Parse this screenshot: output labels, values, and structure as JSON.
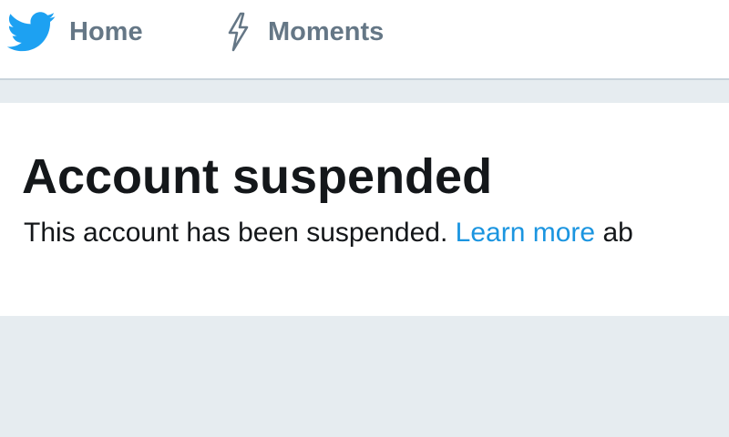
{
  "nav": {
    "home_label": "Home",
    "moments_label": "Moments",
    "brand_icon": "twitter-bird-icon",
    "moments_icon": "lightning-bolt-icon"
  },
  "main": {
    "title": "Account suspended",
    "message": "This account has been suspended.",
    "link_text": "Learn more",
    "trailing_text": "ab"
  },
  "colors": {
    "brand": "#1da1f2",
    "link": "#1b95e0",
    "nav_text": "#657786",
    "background": "#e6ecf0",
    "title_text": "#14171a"
  }
}
